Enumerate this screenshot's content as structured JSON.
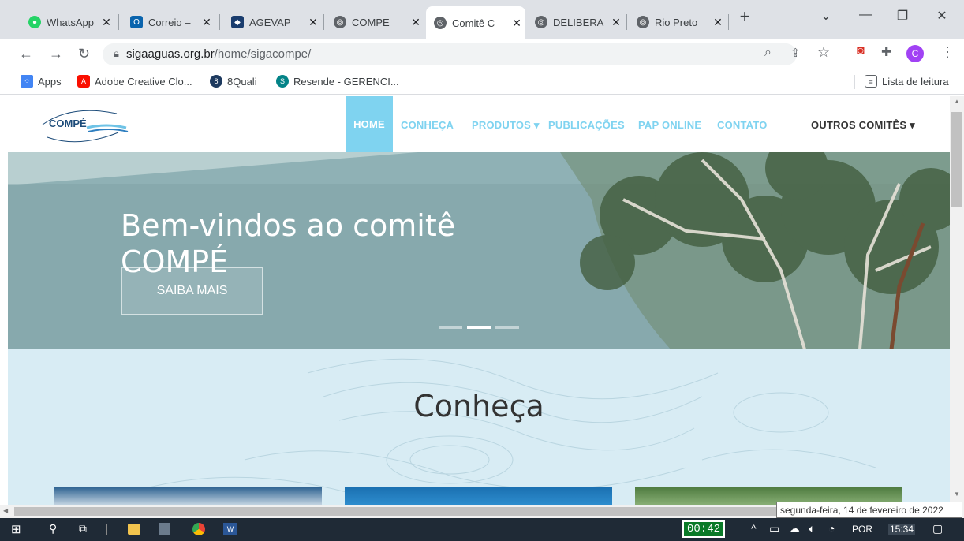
{
  "tabs": [
    {
      "title": "WhatsApp",
      "color": "#25d366",
      "glyph": "●"
    },
    {
      "title": "Correio –",
      "color": "#0a64ad",
      "glyph": "O"
    },
    {
      "title": "AGEVAP",
      "color": "#1a3d6e",
      "glyph": "◆"
    },
    {
      "title": "COMPE",
      "color": "#5f6368",
      "glyph": "◎"
    },
    {
      "title": "Comitê C",
      "color": "#5f6368",
      "glyph": "◎"
    },
    {
      "title": "DELIBERA",
      "color": "#5f6368",
      "glyph": "◎"
    },
    {
      "title": "Rio Preto",
      "color": "#5f6368",
      "glyph": "◎"
    }
  ],
  "browser": {
    "url_domain": "sigaaguas.org.br",
    "url_path": "/home/sigacompe/",
    "profile_initial": "C"
  },
  "bookmarks": [
    {
      "label": "Apps"
    },
    {
      "label": "Adobe Creative Clo..."
    },
    {
      "label": "8Quali"
    },
    {
      "label": "Resende - GERENCI..."
    }
  ],
  "reading_list": "Lista de leitura",
  "site": {
    "logo_text": "COMPÉ",
    "logo_arc_top": "Comitê da Bacia Hidrográfica dos Afluentes",
    "logo_arc_bottom": "Mineiros dos Rios Preto e Paraibuna",
    "menu": [
      "HOME",
      "CONHEÇA",
      "PRODUTOS",
      "PUBLICAÇÕES",
      "PAP ONLINE",
      "CONTATO",
      "OUTROS COMITÊS"
    ],
    "hero_title": "Bem-vindos ao comitê COMPÉ",
    "hero_button": "SAIBA MAIS",
    "section_title": "Conheça"
  },
  "taskbar": {
    "timer": "00:42",
    "lang": "POR",
    "time": "15:34"
  },
  "tooltip": "segunda-feira, 14 de fevereiro de 2022"
}
